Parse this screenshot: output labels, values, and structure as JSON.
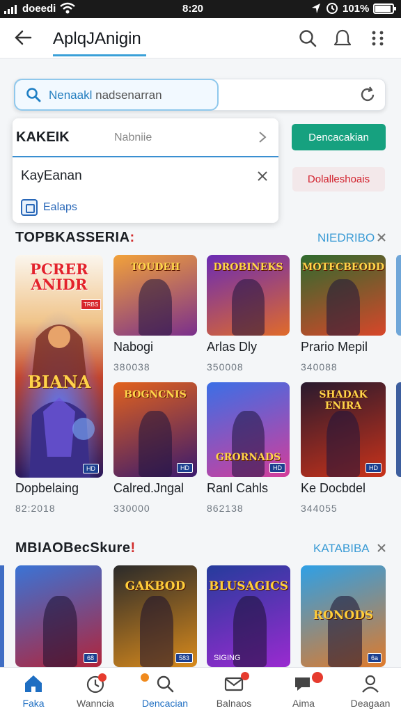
{
  "status": {
    "carrier": "doeedi",
    "time": "8:20",
    "battery": "101%",
    "battery_level": 0.9
  },
  "appbar": {
    "title": "AplqJAnigin"
  },
  "search": {
    "query": "Nenaakl",
    "hint": "nadsenarran"
  },
  "dropdown": {
    "header": "KAKEIK",
    "header_value": "Nabniie",
    "item": "KayEanan",
    "action": "Ealaps"
  },
  "actions": {
    "primary": "Dencacakian",
    "secondary": "Dolalleshoais"
  },
  "section1": {
    "title": "TOPBKASSERIA",
    "mark": ":",
    "link": "NIEDRIBO",
    "featured": {
      "poster_title": "PCRER ANIDR",
      "sign": "TRBS",
      "banner": "BIANA",
      "name": "Dopbelaing",
      "count": "82:2018"
    },
    "games": [
      {
        "name": "Nabogi",
        "count": "380038"
      },
      {
        "name": "Arlas Dly",
        "count": "350008"
      },
      {
        "name": "Prario Mepil",
        "count": "340088"
      },
      {
        "name": "Calred.Jngal",
        "count": "330000"
      },
      {
        "name": "Ranl Cahls",
        "count": "862138"
      },
      {
        "name": "Ke Docbdel",
        "count": "344055"
      }
    ],
    "tile_titles": [
      "TOUDEH",
      "DROBINEKS",
      "MOTFCBEODD",
      "BOGNCNIS",
      "GRORNADS",
      "SHADAK ENIRA"
    ]
  },
  "section2": {
    "title": "MBIAOBecSkure",
    "mark": "!",
    "link": "KATABIBA",
    "tile_titles": [
      "",
      "GAKBOD",
      "BLUSAGICS",
      "RONODS"
    ],
    "tile_tags": [
      "68",
      "583",
      "SIGING",
      "6a"
    ]
  },
  "nav": [
    {
      "label": "Faka",
      "icon": "home-icon"
    },
    {
      "label": "Wanncia",
      "icon": "clock-icon"
    },
    {
      "label": "Dencacian",
      "icon": "search-icon"
    },
    {
      "label": "Balnaos",
      "icon": "mail-icon"
    },
    {
      "label": "Aima",
      "icon": "chat-icon"
    },
    {
      "label": "Deagaan",
      "icon": "profile-icon"
    }
  ],
  "colors": {
    "accent": "#3aa0d8",
    "green": "#16a17f",
    "red": "#d2202c"
  }
}
